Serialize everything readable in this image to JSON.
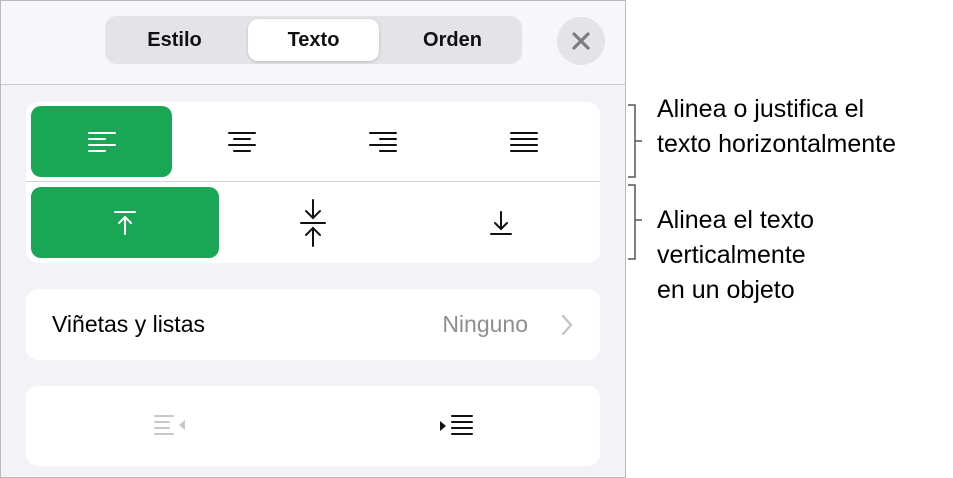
{
  "tabs": [
    {
      "label": "Estilo",
      "selected": false
    },
    {
      "label": "Texto",
      "selected": true
    },
    {
      "label": "Orden",
      "selected": false
    }
  ],
  "icons": {
    "close": "close-icon",
    "align_left": "align-left-icon",
    "align_center": "align-center-icon",
    "align_right": "align-right-icon",
    "justify": "justify-icon",
    "valign_top": "align-top-icon",
    "valign_middle": "align-middle-icon",
    "valign_bottom": "align-bottom-icon",
    "chevron": "chevron-right-icon",
    "outdent": "decrease-indent-icon",
    "indent": "increase-indent-icon"
  },
  "alignment": {
    "horizontal_selected": "left",
    "vertical_selected": "top"
  },
  "bullets": {
    "label": "Viñetas y listas",
    "value": "Ninguno"
  },
  "callouts": {
    "horizontal": [
      "Alinea o justifica el",
      "texto horizontalmente"
    ],
    "vertical": [
      "Alinea el texto",
      "verticalmente",
      "en un objeto"
    ]
  },
  "colors": {
    "accent": "#19a655",
    "panel_bg": "#f2f2f7",
    "secondary_text": "#8e8e93",
    "disabled_icon": "#c7c7cc"
  }
}
